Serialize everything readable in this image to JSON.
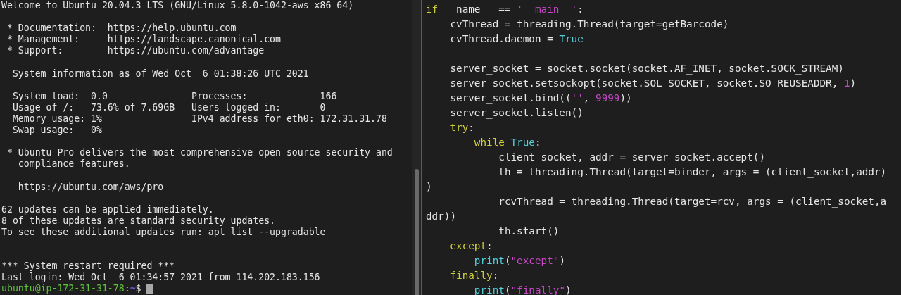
{
  "terminal": {
    "lines": [
      {
        "kind": "text",
        "segments": [
          {
            "kind": "plain",
            "text": "Welcome to Ubuntu 20.04.3 LTS (GNU/Linux 5.8.0-1042-aws x86_64)"
          }
        ]
      },
      {
        "kind": "blank"
      },
      {
        "kind": "text",
        "segments": [
          {
            "kind": "plain",
            "text": " * Documentation:  https://help.ubuntu.com"
          }
        ]
      },
      {
        "kind": "text",
        "segments": [
          {
            "kind": "plain",
            "text": " * Management:     https://landscape.canonical.com"
          }
        ]
      },
      {
        "kind": "text",
        "segments": [
          {
            "kind": "plain",
            "text": " * Support:        https://ubuntu.com/advantage"
          }
        ]
      },
      {
        "kind": "blank"
      },
      {
        "kind": "text",
        "segments": [
          {
            "kind": "plain",
            "text": "  System information as of Wed Oct  6 01:38:26 UTC 2021"
          }
        ]
      },
      {
        "kind": "blank"
      },
      {
        "kind": "text",
        "segments": [
          {
            "kind": "plain",
            "text": "  System load:  0.0               Processes:             166"
          }
        ]
      },
      {
        "kind": "text",
        "segments": [
          {
            "kind": "plain",
            "text": "  Usage of /:   73.6% of 7.69GB   Users logged in:       0"
          }
        ]
      },
      {
        "kind": "text",
        "segments": [
          {
            "kind": "plain",
            "text": "  Memory usage: 1%                IPv4 address for eth0: 172.31.31.78"
          }
        ]
      },
      {
        "kind": "text",
        "segments": [
          {
            "kind": "plain",
            "text": "  Swap usage:   0%"
          }
        ]
      },
      {
        "kind": "blank"
      },
      {
        "kind": "text",
        "segments": [
          {
            "kind": "plain",
            "text": " * Ubuntu Pro delivers the most comprehensive open source security and"
          }
        ]
      },
      {
        "kind": "text",
        "segments": [
          {
            "kind": "plain",
            "text": "   compliance features."
          }
        ]
      },
      {
        "kind": "blank"
      },
      {
        "kind": "text",
        "segments": [
          {
            "kind": "plain",
            "text": "   https://ubuntu.com/aws/pro"
          }
        ]
      },
      {
        "kind": "blank"
      },
      {
        "kind": "text",
        "segments": [
          {
            "kind": "plain",
            "text": "62 updates can be applied immediately."
          }
        ]
      },
      {
        "kind": "text",
        "segments": [
          {
            "kind": "plain",
            "text": "8 of these updates are standard security updates."
          }
        ]
      },
      {
        "kind": "text",
        "segments": [
          {
            "kind": "plain",
            "text": "To see these additional updates run: apt list --upgradable"
          }
        ]
      },
      {
        "kind": "blank"
      },
      {
        "kind": "blank"
      },
      {
        "kind": "text",
        "segments": [
          {
            "kind": "plain",
            "text": "*** System restart required ***"
          }
        ]
      },
      {
        "kind": "text",
        "segments": [
          {
            "kind": "plain",
            "text": "Last login: Wed Oct  6 01:34:57 2021 from 114.202.183.156"
          }
        ]
      },
      {
        "kind": "prompt",
        "segments": [
          {
            "kind": "user",
            "text": "ubuntu@ip-172-31-31-78"
          },
          {
            "kind": "plain",
            "text": ":"
          },
          {
            "kind": "path",
            "text": "~"
          },
          {
            "kind": "plain",
            "text": "$ "
          }
        ]
      }
    ]
  },
  "editor": {
    "lines": [
      {
        "kind": "text",
        "segments": [
          {
            "kind": "keyword",
            "text": "if"
          },
          {
            "kind": "plain",
            "text": " __name__ == "
          },
          {
            "kind": "string",
            "text": "'__main__'"
          },
          {
            "kind": "plain",
            "text": ":"
          }
        ]
      },
      {
        "kind": "text",
        "segments": [
          {
            "kind": "plain",
            "text": "    cvThread = threading.Thread(target=getBarcode)"
          }
        ]
      },
      {
        "kind": "text",
        "segments": [
          {
            "kind": "plain",
            "text": "    cvThread.daemon = "
          },
          {
            "kind": "constant",
            "text": "True"
          }
        ]
      },
      {
        "kind": "blank"
      },
      {
        "kind": "text",
        "segments": [
          {
            "kind": "plain",
            "text": "    server_socket = socket.socket(socket.AF_INET, socket.SOCK_STREAM)"
          }
        ]
      },
      {
        "kind": "text",
        "segments": [
          {
            "kind": "plain",
            "text": "    server_socket.setsockopt(socket.SOL_SOCKET, socket.SO_REUSEADDR, "
          },
          {
            "kind": "number",
            "text": "1"
          },
          {
            "kind": "plain",
            "text": ")"
          }
        ]
      },
      {
        "kind": "text",
        "segments": [
          {
            "kind": "plain",
            "text": "    server_socket.bind(("
          },
          {
            "kind": "string",
            "text": "''"
          },
          {
            "kind": "plain",
            "text": ", "
          },
          {
            "kind": "number",
            "text": "9999"
          },
          {
            "kind": "plain",
            "text": "))"
          }
        ]
      },
      {
        "kind": "text",
        "segments": [
          {
            "kind": "plain",
            "text": "    server_socket.listen()"
          }
        ]
      },
      {
        "kind": "text",
        "segments": [
          {
            "kind": "keyword",
            "text": "    try"
          },
          {
            "kind": "plain",
            "text": ":"
          }
        ]
      },
      {
        "kind": "text",
        "segments": [
          {
            "kind": "keyword",
            "text": "        while "
          },
          {
            "kind": "constant",
            "text": "True"
          },
          {
            "kind": "plain",
            "text": ":"
          }
        ]
      },
      {
        "kind": "text",
        "segments": [
          {
            "kind": "plain",
            "text": "            client_socket, addr = server_socket.accept()"
          }
        ]
      },
      {
        "kind": "text",
        "segments": [
          {
            "kind": "plain",
            "text": "            th = threading.Thread(target=binder, args = (client_socket,addr)"
          }
        ]
      },
      {
        "kind": "text",
        "segments": [
          {
            "kind": "plain",
            "text": ")"
          }
        ]
      },
      {
        "kind": "text",
        "segments": [
          {
            "kind": "plain",
            "text": "            rcvThread = threading.Thread(target=rcv, args = (client_socket,a"
          }
        ]
      },
      {
        "kind": "text",
        "segments": [
          {
            "kind": "plain",
            "text": "ddr))"
          }
        ]
      },
      {
        "kind": "text",
        "segments": [
          {
            "kind": "plain",
            "text": "            th.start()"
          }
        ]
      },
      {
        "kind": "text",
        "segments": [
          {
            "kind": "keyword",
            "text": "    except"
          },
          {
            "kind": "plain",
            "text": ":"
          }
        ]
      },
      {
        "kind": "text",
        "segments": [
          {
            "kind": "constant",
            "text": "        print"
          },
          {
            "kind": "plain",
            "text": "("
          },
          {
            "kind": "string",
            "text": "\"except\""
          },
          {
            "kind": "plain",
            "text": ")"
          }
        ]
      },
      {
        "kind": "text",
        "segments": [
          {
            "kind": "keyword",
            "text": "    finally"
          },
          {
            "kind": "plain",
            "text": ":"
          }
        ]
      },
      {
        "kind": "text",
        "segments": [
          {
            "kind": "constant",
            "text": "        print"
          },
          {
            "kind": "plain",
            "text": "("
          },
          {
            "kind": "string",
            "text": "\"finally\""
          },
          {
            "kind": "plain",
            "text": ")"
          }
        ]
      }
    ]
  }
}
